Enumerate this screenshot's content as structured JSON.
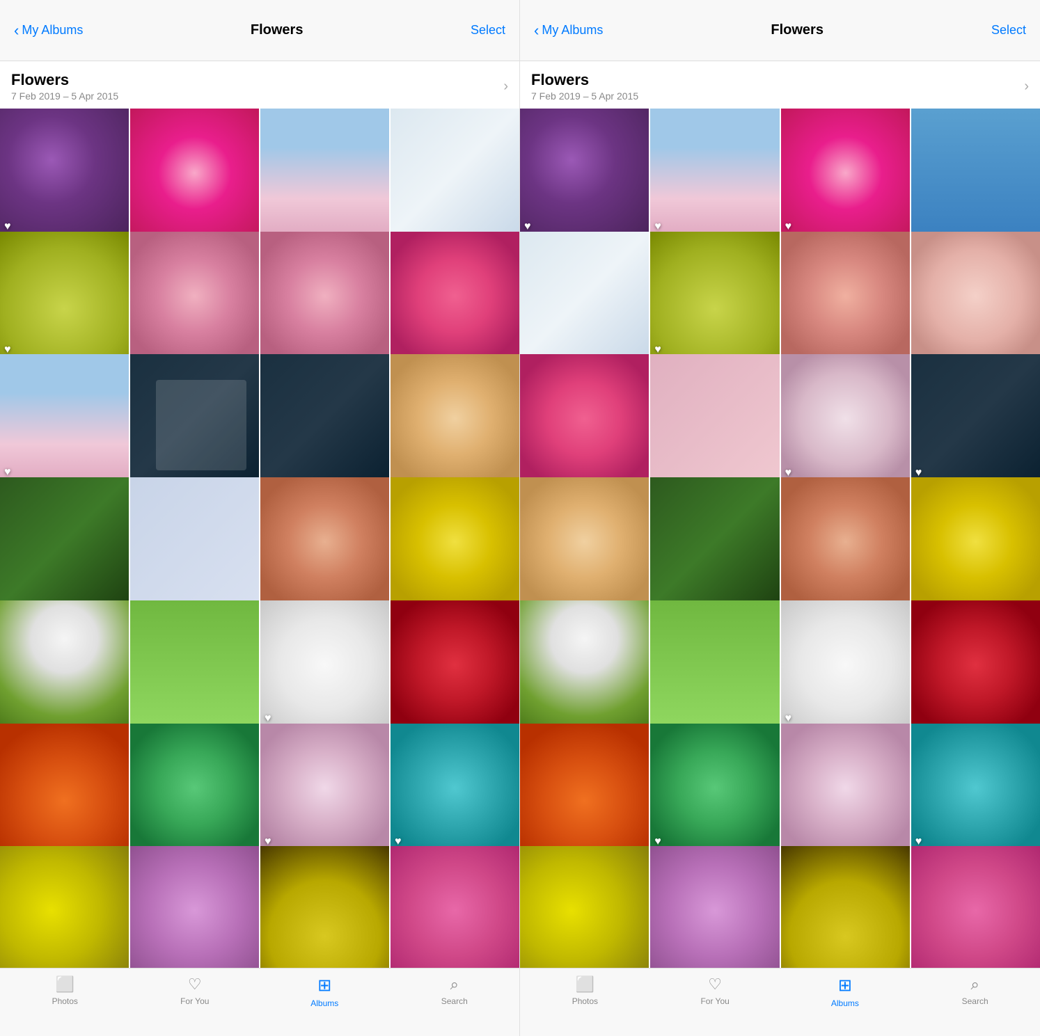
{
  "panels": [
    {
      "id": "left",
      "nav": {
        "back_label": "My Albums",
        "title": "Flowers",
        "select_label": "Select"
      },
      "album_header": {
        "title": "Flowers",
        "date_range": "7 Feb 2019 – 5 Apr 2015",
        "chevron": "›"
      },
      "tab_bar": {
        "items": [
          {
            "id": "photos",
            "label": "Photos",
            "icon": "□",
            "active": false
          },
          {
            "id": "for-you",
            "label": "For You",
            "icon": "♡",
            "active": false
          },
          {
            "id": "albums",
            "label": "Albums",
            "icon": "▦",
            "active": true
          },
          {
            "id": "search",
            "label": "Search",
            "icon": "⌕",
            "active": false
          }
        ]
      }
    },
    {
      "id": "right",
      "nav": {
        "back_label": "My Albums",
        "title": "Flowers",
        "select_label": "Select"
      },
      "album_header": {
        "title": "Flowers",
        "date_range": "7 Feb 2019 – 5 Apr 2015",
        "chevron": "›"
      },
      "tab_bar": {
        "items": [
          {
            "id": "photos",
            "label": "Photos",
            "icon": "□",
            "active": false
          },
          {
            "id": "for-you",
            "label": "For You",
            "icon": "♡",
            "active": false
          },
          {
            "id": "albums",
            "label": "Albums",
            "icon": "▦",
            "active": true
          },
          {
            "id": "search",
            "label": "Search",
            "icon": "⌕",
            "active": false
          }
        ]
      }
    }
  ],
  "photo_grid": {
    "rows": 7,
    "cols": 4,
    "cells": [
      {
        "id": 0,
        "color": "cell-purple",
        "heart": true
      },
      {
        "id": 1,
        "color": "cell-pink-hibiscus",
        "heart": false
      },
      {
        "id": 2,
        "color": "cell-cherry-blossom",
        "heart": false
      },
      {
        "id": 3,
        "color": "cell-orchid-white",
        "heart": false
      },
      {
        "id": 4,
        "color": "cell-wild-yellow",
        "heart": true
      },
      {
        "id": 5,
        "color": "cell-mixed-pink",
        "heart": false
      },
      {
        "id": 6,
        "color": "cell-mixed-pink",
        "heart": false
      },
      {
        "id": 7,
        "color": "cell-gerbera-pink",
        "heart": false
      },
      {
        "id": 8,
        "color": "cell-cherry-blossom",
        "heart": true
      },
      {
        "id": 9,
        "color": "cell-ghost",
        "heart": false
      },
      {
        "id": 10,
        "color": "cell-dark-floral",
        "heart": false
      },
      {
        "id": 11,
        "color": "cell-peach-daisy",
        "heart": false
      },
      {
        "id": 12,
        "color": "cell-green-leaf",
        "heart": false
      },
      {
        "id": 13,
        "color": "cell-blue-bg",
        "heart": false
      },
      {
        "id": 14,
        "color": "cell-rose-peach",
        "heart": false
      },
      {
        "id": 15,
        "color": "cell-yellow-petal",
        "heart": false
      },
      {
        "id": 16,
        "color": "cell-dandelion",
        "heart": false
      },
      {
        "id": 17,
        "color": "cell-daffodil",
        "heart": false
      },
      {
        "id": 18,
        "color": "cell-white-flower",
        "heart": true
      },
      {
        "id": 19,
        "color": "cell-red-rose",
        "heart": false
      },
      {
        "id": 20,
        "color": "cell-orange-tulip",
        "heart": false
      },
      {
        "id": 21,
        "color": "cell-succulent",
        "heart": false
      },
      {
        "id": 22,
        "color": "cell-pink-magnolia",
        "heart": true
      },
      {
        "id": 23,
        "color": "cell-teal-succulent",
        "heart": true
      },
      {
        "id": 24,
        "color": "cell-yellow-daffodil",
        "heart": false
      },
      {
        "id": 25,
        "color": "cell-purple-flower",
        "heart": false
      },
      {
        "id": 26,
        "color": "cell-yellow-daffodil",
        "heart": false
      },
      {
        "id": 27,
        "color": "cell-pink-mixed",
        "heart": false
      }
    ]
  }
}
